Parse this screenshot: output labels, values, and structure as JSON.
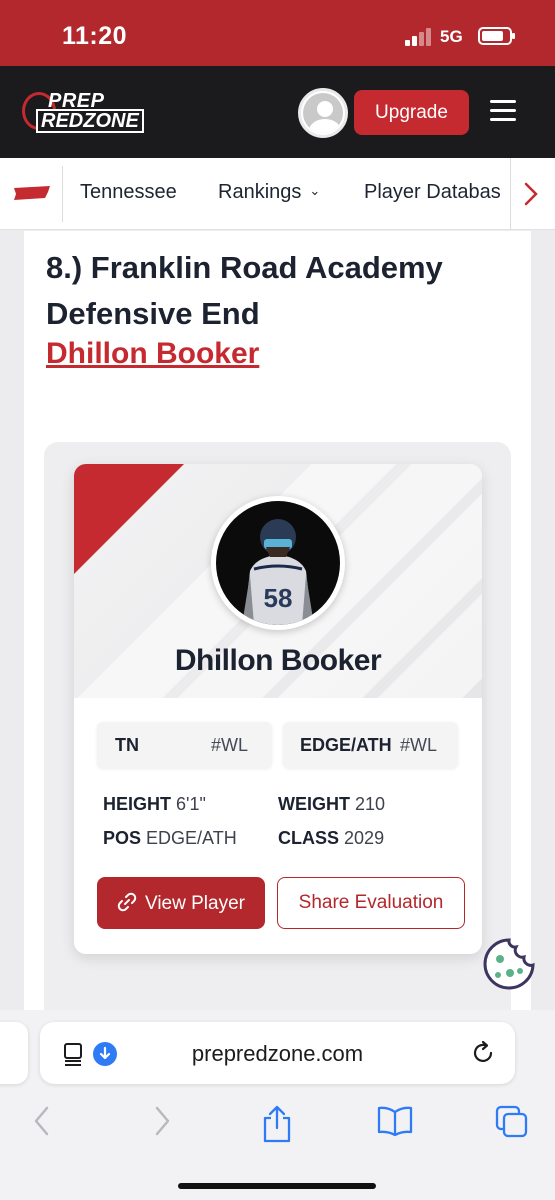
{
  "status_bar": {
    "time": "11:20",
    "network": "5G",
    "battery_level": 0.8
  },
  "header": {
    "logo_line1": "PREP",
    "logo_line2": "REDZONE",
    "upgrade_label": "Upgrade"
  },
  "nav": {
    "items": [
      {
        "label": "Tennessee"
      },
      {
        "label": "Rankings"
      },
      {
        "label": "Player Databas"
      }
    ]
  },
  "article": {
    "heading": "8.) Franklin Road Academy Defensive End",
    "player_link": "Dhillon Booker"
  },
  "player_card": {
    "name": "Dhillon Booker",
    "jersey_number": "58",
    "chips": [
      {
        "label": "TN",
        "rank": "#WL"
      },
      {
        "label": "EDGE/ATH",
        "rank": "#WL"
      }
    ],
    "stats": {
      "height_label": "HEIGHT",
      "height_value": "6'1\"",
      "weight_label": "WEIGHT",
      "weight_value": "210",
      "pos_label": "POS",
      "pos_value": "EDGE/ATH",
      "class_label": "CLASS",
      "class_value": "2029"
    },
    "view_player_label": "View Player",
    "share_label": "Share Evaluation"
  },
  "browser": {
    "url": "prepredzone.com"
  },
  "colors": {
    "brand_red": "#c42a2f",
    "header_black": "#1b1b1d",
    "ios_blue": "#2f7bf6"
  }
}
